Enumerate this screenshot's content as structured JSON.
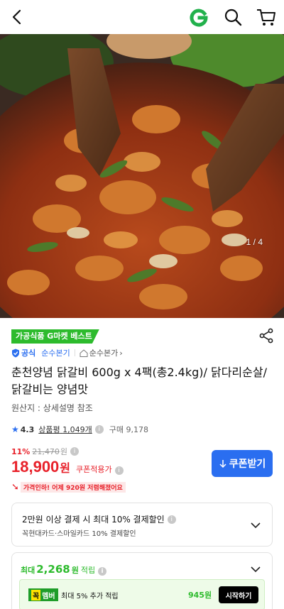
{
  "header": {
    "back_icon": "chevron-left-icon",
    "logo_letter": "G",
    "logo_color": "#22b14c",
    "search_icon": "search-icon",
    "cart_icon": "cart-icon"
  },
  "hero": {
    "pager": "1 / 4"
  },
  "product": {
    "badge": "가공식품 G마켓 베스트",
    "official_label": "공식",
    "shop_link": "순수본기",
    "shop_name": "순수본가",
    "title": "춘천양념 닭갈비 600g x 4팩(총2.4kg)/ 닭다리순살/ 닭갈비는 양념맛",
    "origin": "원산지 : 상세설명 참조",
    "rating": "4.3",
    "review_label": "상품평",
    "review_count": "1,049개",
    "purchase_label": "구매",
    "purchase_count": "9,178",
    "discount_rate": "11%",
    "original_price": "21,470",
    "original_unit": "원",
    "price": "18,900",
    "price_unit": "원",
    "coupon_applied": "쿠폰적용가",
    "coupon_button": "쿠폰받기",
    "price_drop": "가격인하! 어제 920원 저렴해졌어요"
  },
  "payment_card": {
    "title": "2만원 이상 결제 시 최대 10% 결제할인",
    "subtitle": "꼭현대카드·스마일카드 10% 결제할인"
  },
  "points_card": {
    "prefix": "최대",
    "amount": "2,268",
    "unit": "원",
    "label": "적립",
    "member_tag_kko": "꼭",
    "member_tag": "멤버",
    "member_text": "최대 5% 추가 적립",
    "member_amount": "945원",
    "start_button": "시작하기"
  },
  "colors": {
    "accent_blue": "#2a6ef0",
    "price_red": "#e8212a",
    "green": "#2dbb2d"
  }
}
